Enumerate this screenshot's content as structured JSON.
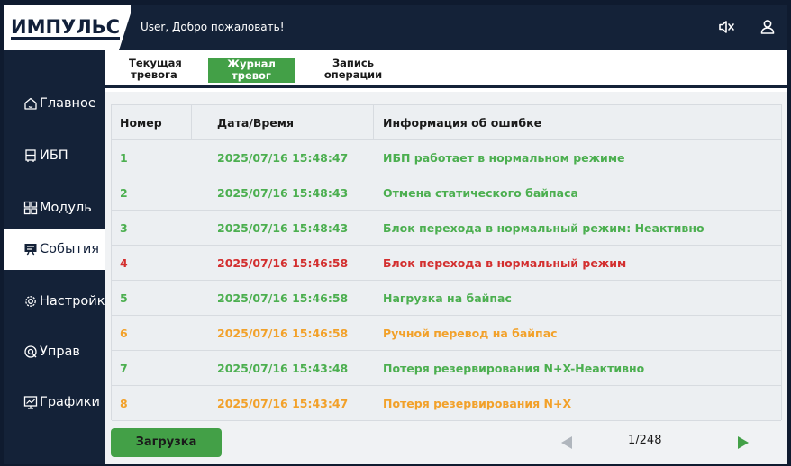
{
  "header": {
    "logo_text": "ИМПУЛЬС",
    "welcome": "User, Добро пожаловать!",
    "icons": [
      "mute-icon",
      "user-icon"
    ]
  },
  "sidebar": {
    "items": [
      {
        "label": "Главное",
        "icon": "home-icon",
        "active": false
      },
      {
        "label": "ИБП",
        "icon": "ups-icon",
        "active": false
      },
      {
        "label": "Модуль",
        "icon": "module-icon",
        "active": false
      },
      {
        "label": "События",
        "icon": "events-icon",
        "active": true
      },
      {
        "label": "Настройк",
        "icon": "gear-icon",
        "active": false
      },
      {
        "label": "Управ",
        "icon": "control-icon",
        "active": false
      },
      {
        "label": "Графики",
        "icon": "chart-icon",
        "active": false
      }
    ]
  },
  "tabs": [
    {
      "line1": "Текущая",
      "line2": "тревога",
      "active": false
    },
    {
      "line1": "Журнал",
      "line2": "тревог",
      "active": true
    },
    {
      "line1": "Запись",
      "line2": "операции",
      "active": false
    }
  ],
  "table": {
    "columns": [
      "Номер",
      "Дата/Время",
      "Информация об ошибке"
    ],
    "rows": [
      {
        "num": "1",
        "datetime": "2025/07/16 15:48:47",
        "info": "ИБП работает в нормальном режиме",
        "color": "#4caf50"
      },
      {
        "num": "2",
        "datetime": "2025/07/16 15:48:43",
        "info": "Отмена статического байпаса",
        "color": "#4caf50"
      },
      {
        "num": "3",
        "datetime": "2025/07/16 15:48:43",
        "info": "Блок перехода в нормальный режим: Неактивно",
        "color": "#4caf50"
      },
      {
        "num": "4",
        "datetime": "2025/07/16 15:46:58",
        "info": "Блок перехода в нормальный режим",
        "color": "#d32f2f"
      },
      {
        "num": "5",
        "datetime": "2025/07/16 15:46:58",
        "info": "Нагрузка на байпас",
        "color": "#4caf50"
      },
      {
        "num": "6",
        "datetime": "2025/07/16 15:46:58",
        "info": "Ручной перевод на байпас",
        "color": "#f2a12a"
      },
      {
        "num": "7",
        "datetime": "2025/07/16 15:43:48",
        "info": "Потеря резервирования N+X-Неактивно",
        "color": "#4caf50"
      },
      {
        "num": "8",
        "datetime": "2025/07/16 15:43:47",
        "info": "Потеря резервирования N+X",
        "color": "#f2a12a"
      }
    ]
  },
  "footer": {
    "load_button": "Загрузка",
    "page_indicator": "1/248"
  },
  "colors": {
    "accent": "#43a047",
    "navy": "#142238",
    "error": "#d32f2f",
    "warning": "#f2a12a",
    "ok": "#4caf50"
  }
}
